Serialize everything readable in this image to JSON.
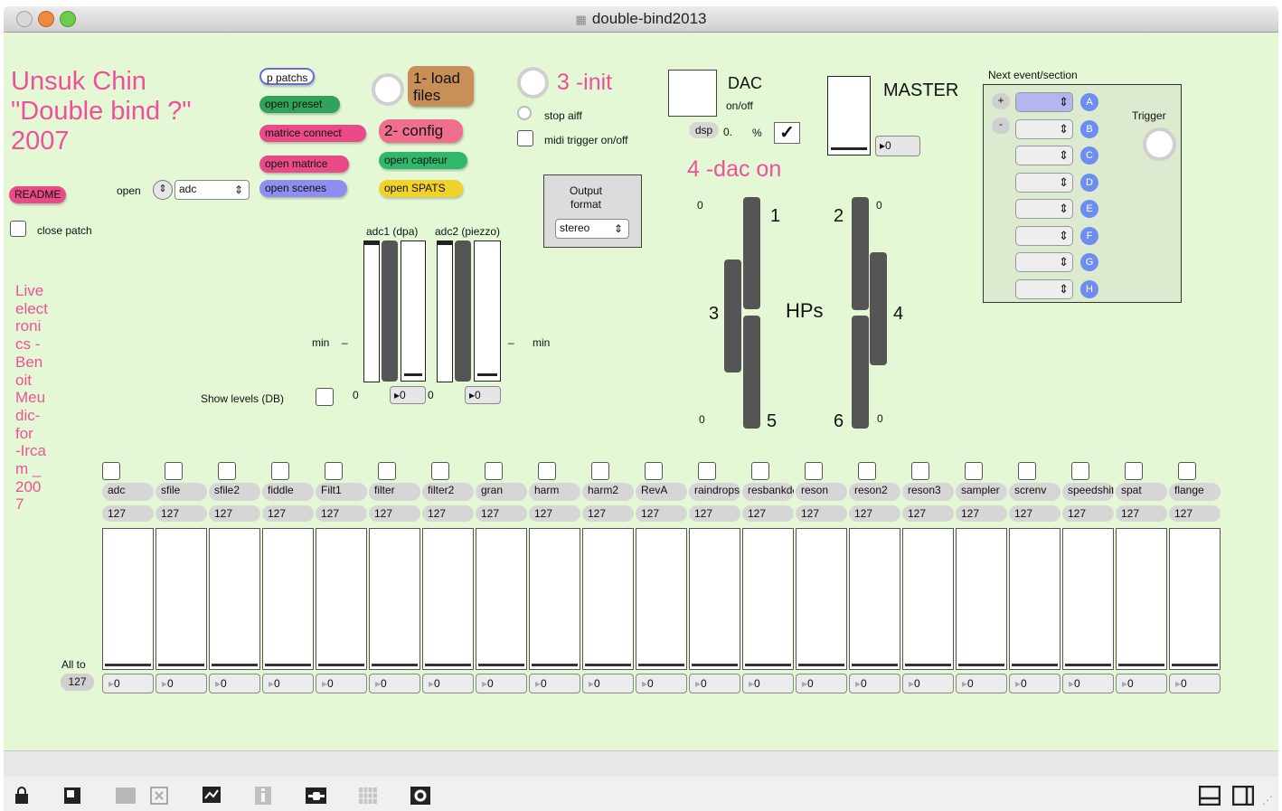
{
  "window": {
    "title": "double-bind2013"
  },
  "header": {
    "composer": "Unsuk Chin",
    "piece": "\"Double bind ?\"",
    "year": "2007",
    "readme": "README",
    "close_patch": "close patch",
    "open_label": "open",
    "open_select": "adc",
    "credits_lines": [
      "Live",
      "elect",
      "roni",
      "cs -",
      "Ben",
      "oit",
      "Meu",
      "dic-",
      "for",
      "-Irca",
      "m _",
      "200",
      "7"
    ]
  },
  "buttons": {
    "p_patchs": "p patchs",
    "open_preset": "open preset",
    "matrice_connect": "matrice connect",
    "open_matrice": "open matrice",
    "open_scenes": "open scenes",
    "load_files": "1- load files",
    "config": "2- config",
    "open_capteur": "open capteur",
    "open_spats": "open SPATS",
    "init": "3 -init",
    "stop_aiff": "stop aiff",
    "midi_trigger": "midi trigger on/off",
    "dac_on": "4 -dac on"
  },
  "output": {
    "label": "Output format",
    "value": "stereo"
  },
  "dac": {
    "title": "DAC",
    "onoff": "on/off",
    "dsp": "dsp",
    "dsp_value": "0.",
    "percent": "%"
  },
  "master": {
    "title": "MASTER",
    "value": "0"
  },
  "inputs": {
    "adc1": "adc1 (dpa)",
    "adc2": "adc2 (piezzo)",
    "min_left": "min",
    "min_right": "min",
    "dash": "–",
    "show_levels": "Show levels (DB)",
    "zero": "0",
    "adc1_value": "0",
    "adc2_value": "0"
  },
  "hps": {
    "label": "HPs",
    "speakers": [
      "1",
      "2",
      "3",
      "4",
      "5",
      "6"
    ],
    "zero": "0"
  },
  "events": {
    "title": "Next event/section",
    "plus": "+",
    "minus": "-",
    "trigger": "Trigger",
    "letters": [
      "A",
      "B",
      "C",
      "D",
      "E",
      "F",
      "G",
      "H"
    ]
  },
  "mixer": {
    "all_to": "All to",
    "all_value": "127",
    "channels": [
      {
        "name": "adc",
        "gain": "127",
        "value": "0"
      },
      {
        "name": "sfile",
        "gain": "127",
        "value": "0"
      },
      {
        "name": "sfile2",
        "gain": "127",
        "value": "0"
      },
      {
        "name": "fiddle",
        "gain": "127",
        "value": "0"
      },
      {
        "name": "Filt1",
        "gain": "127",
        "value": "0"
      },
      {
        "name": "filter",
        "gain": "127",
        "value": "0"
      },
      {
        "name": "filter2",
        "gain": "127",
        "value": "0"
      },
      {
        "name": "gran",
        "gain": "127",
        "value": "0"
      },
      {
        "name": "harm",
        "gain": "127",
        "value": "0"
      },
      {
        "name": "harm2",
        "gain": "127",
        "value": "0"
      },
      {
        "name": "RevA",
        "gain": "127",
        "value": "0"
      },
      {
        "name": "raindrops",
        "gain": "127",
        "value": "0"
      },
      {
        "name": "resbankdelay",
        "gain": "127",
        "value": "0"
      },
      {
        "name": "reson",
        "gain": "127",
        "value": "0"
      },
      {
        "name": "reson2",
        "gain": "127",
        "value": "0"
      },
      {
        "name": "reson3",
        "gain": "127",
        "value": "0"
      },
      {
        "name": "sampler",
        "gain": "127",
        "value": "0"
      },
      {
        "name": "screnv",
        "gain": "127",
        "value": "0"
      },
      {
        "name": "speedshift",
        "gain": "127",
        "value": "0"
      },
      {
        "name": "spat",
        "gain": "127",
        "value": "0"
      },
      {
        "name": "flange",
        "gain": "127",
        "value": "0"
      }
    ]
  },
  "colors": {
    "canvas": "#e4f8d6",
    "pink_text": "#f0509a",
    "preset_green": "#2fa35a",
    "matrice_pink": "#ea4a88",
    "scenes_purple": "#8f8ef0",
    "load_brown": "#c89058",
    "config_pink": "#f06e8e",
    "capteur_green": "#2fb86a",
    "spats_yellow": "#f0d22a",
    "event_blue": "#6e8df0"
  },
  "toolbar": {
    "icons": [
      "lock-icon",
      "new-object-icon",
      "patch-icon",
      "delete-icon",
      "presentation-icon",
      "info-icon",
      "connect-icon",
      "grid-icon",
      "gear-icon",
      "split-view-icon",
      "sidebar-icon"
    ]
  }
}
